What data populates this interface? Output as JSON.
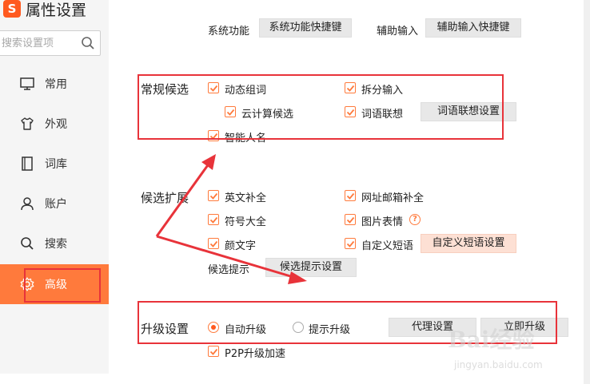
{
  "app": {
    "logo_char": "S",
    "title": "属性设置"
  },
  "search": {
    "placeholder": "搜索设置项"
  },
  "sidebar": {
    "items": [
      {
        "label": "常用",
        "icon": "monitor-icon"
      },
      {
        "label": "外观",
        "icon": "shirt-icon"
      },
      {
        "label": "词库",
        "icon": "book-icon"
      },
      {
        "label": "账户",
        "icon": "user-icon"
      },
      {
        "label": "搜索",
        "icon": "search-icon"
      },
      {
        "label": "高级",
        "icon": "gear-icon",
        "active": true
      }
    ]
  },
  "top_row": {
    "system_label": "系统功能",
    "system_button": "系统功能快捷键",
    "assist_label": "辅助输入",
    "assist_button": "辅助输入快捷键"
  },
  "regular": {
    "title": "常规候选",
    "dynamic_words": {
      "label": "动态组词",
      "checked": true
    },
    "split_input": {
      "label": "拆分输入",
      "checked": true
    },
    "cloud": {
      "label": "云计算候选",
      "checked": true
    },
    "association": {
      "label": "词语联想",
      "checked": true
    },
    "association_button": "词语联想设置",
    "smart_names": {
      "label": "智能人名",
      "checked": true
    }
  },
  "extension": {
    "title": "候选扩展",
    "english": {
      "label": "英文补全",
      "checked": true
    },
    "url_email": {
      "label": "网址邮箱补全",
      "checked": true
    },
    "symbols": {
      "label": "符号大全",
      "checked": true
    },
    "emoji_images": {
      "label": "图片表情",
      "checked": true
    },
    "kaomoji": {
      "label": "颜文字",
      "checked": true
    },
    "custom_phrase": {
      "label": "自定义短语",
      "checked": true
    },
    "custom_phrase_button": "自定义短语设置",
    "hint_label": "候选提示",
    "hint_button": "候选提示设置"
  },
  "upgrade": {
    "title": "升级设置",
    "auto": {
      "label": "自动升级",
      "selected": true
    },
    "prompt": {
      "label": "提示升级",
      "selected": false
    },
    "proxy_button": "代理设置",
    "now_button": "立即升级",
    "p2p": {
      "label": "P2P升级加速",
      "checked": true
    }
  },
  "colors": {
    "accent": "#ff7a3c",
    "annotation": "#e8333a"
  },
  "watermark": {
    "text": "Bai经验",
    "sub": "jingyan.baidu.com"
  }
}
